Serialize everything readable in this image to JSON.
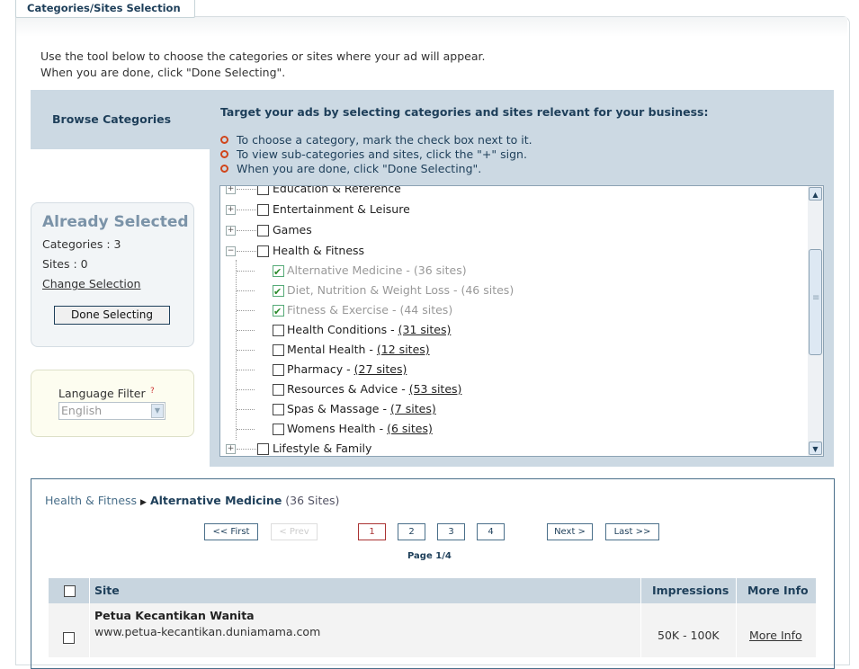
{
  "tab": {
    "title": "Categories/Sites Selection"
  },
  "intro": {
    "line1": "Use the tool below to choose the categories or sites where your ad will appear.",
    "line2": "When you are done, click \"Done Selecting\"."
  },
  "browse": {
    "title": "Browse Categories",
    "target_title": "Target your ads by selecting categories and sites relevant for your business:",
    "bullets": [
      "To choose a category, mark the check box next to it.",
      "To view sub-categories and sites, click the \"+\" sign.",
      "When you are done, click \"Done Selecting\"."
    ]
  },
  "tree": {
    "items": [
      {
        "label": "Education & Reference",
        "expander": "+",
        "checked": false
      },
      {
        "label": "Entertainment & Leisure",
        "expander": "+",
        "checked": false
      },
      {
        "label": "Games",
        "expander": "+",
        "checked": false
      },
      {
        "label": "Health & Fitness",
        "expander": "−",
        "checked": false
      },
      {
        "label": "Alternative Medicine - ",
        "sites": "(36 sites)",
        "checked": true
      },
      {
        "label": "Diet, Nutrition & Weight Loss - ",
        "sites": "(46 sites)",
        "checked": true
      },
      {
        "label": "Fitness & Exercise - ",
        "sites": "(44 sites)",
        "checked": true
      },
      {
        "label": "Health Conditions - ",
        "sites": "(31 sites)",
        "checked": false
      },
      {
        "label": "Mental Health - ",
        "sites": "(12 sites)",
        "checked": false
      },
      {
        "label": "Pharmacy - ",
        "sites": "(27 sites)",
        "checked": false
      },
      {
        "label": "Resources & Advice - ",
        "sites": "(53 sites)",
        "checked": false
      },
      {
        "label": "Spas & Massage - ",
        "sites": "(7 sites)",
        "checked": false
      },
      {
        "label": "Womens Health - ",
        "sites": "(6 sites)",
        "checked": false
      },
      {
        "label": "Lifestyle & Family",
        "expander": "+",
        "checked": false
      }
    ]
  },
  "already": {
    "title": "Already Selected",
    "categories": "Categories : 3",
    "sites": "Sites : 0",
    "change": "Change Selection",
    "done": "Done Selecting"
  },
  "language": {
    "label": "Language Filter",
    "help": "?",
    "value": "English"
  },
  "results": {
    "crumb_parent": "Health & Fitness",
    "crumb_arrow": "▶",
    "crumb_current": "Alternative Medicine",
    "crumb_count": " (36 Sites)",
    "pager": {
      "first": "<< First",
      "prev": "< Prev",
      "pages": [
        "1",
        "2",
        "3",
        "4"
      ],
      "next": "Next >",
      "last": "Last >>",
      "info": "Page 1/4"
    },
    "columns": {
      "site": "Site",
      "impressions": "Impressions",
      "more": "More Info"
    },
    "rows": [
      {
        "name": "Petua Kecantikan Wanita",
        "url": "www.petua-kecantikan.duniamama.com",
        "impressions": "50K - 100K",
        "more": "More Info"
      }
    ]
  },
  "icons": {
    "plus": "plus-expander-icon",
    "minus": "minus-expander-icon",
    "scroll_up": "scroll-up-icon",
    "scroll_down": "scroll-down-icon"
  },
  "colors": {
    "accent": "#1e3f5a",
    "panel": "#ccd9e3",
    "bullet": "#d0451b",
    "check": "#2a8a2a"
  }
}
